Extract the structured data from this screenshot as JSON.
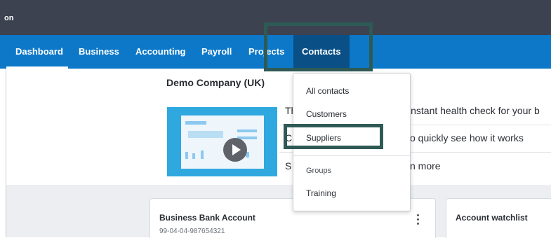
{
  "header": {
    "org_name": "on"
  },
  "nav": {
    "tabs": [
      {
        "label": "Dashboard"
      },
      {
        "label": "Business"
      },
      {
        "label": "Accounting"
      },
      {
        "label": "Payroll"
      },
      {
        "label": "Projects"
      },
      {
        "label": "Contacts"
      }
    ]
  },
  "main": {
    "company_name": "Demo Company (UK)",
    "line1_start": "Th",
    "line1_end": "instant health check for your b",
    "line2_start": "C",
    "line2_end": "o quickly see how it works",
    "line3_start": "S",
    "line3_end": "n more"
  },
  "dropdown": {
    "items": [
      {
        "label": "All contacts"
      },
      {
        "label": "Customers"
      },
      {
        "label": "Suppliers"
      },
      {
        "label": "Groups"
      },
      {
        "label": "Training"
      }
    ]
  },
  "cards": {
    "bank": {
      "title": "Business Bank Account",
      "account_number": "99-04-04-987654321"
    },
    "watchlist": {
      "title": "Account watchlist"
    }
  },
  "colors": {
    "topbar": "#3c4250",
    "navbar": "#0d78c8",
    "active_tab": "#0a4f86",
    "highlight_box": "#2e5a55"
  }
}
